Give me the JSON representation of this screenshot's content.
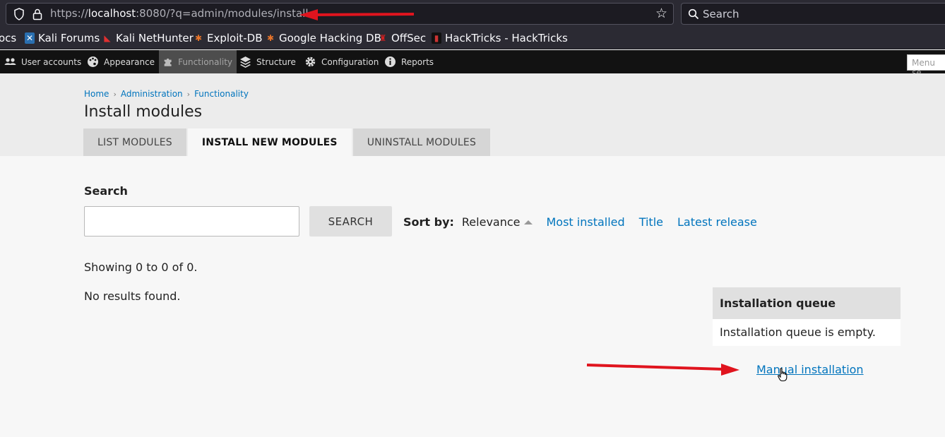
{
  "browser": {
    "url_scheme": "https://",
    "url_host": "localhost",
    "url_rest": ":8080/?q=admin/modules/install",
    "search_placeholder": "Search",
    "bookmarks": [
      {
        "label": "ocs",
        "icon": ""
      },
      {
        "label": "Kali Forums",
        "icon": "kali-forums-icon"
      },
      {
        "label": "Kali NetHunter",
        "icon": "nethunter-icon"
      },
      {
        "label": "Exploit-DB",
        "icon": "exploit-db-icon"
      },
      {
        "label": "Google Hacking DB",
        "icon": "ghdb-icon"
      },
      {
        "label": "OffSec",
        "icon": "offsec-icon"
      },
      {
        "label": "HackTricks - HackTricks",
        "icon": "hacktricks-icon"
      }
    ]
  },
  "toolbar": {
    "items": [
      {
        "label": "User accounts",
        "icon": "users-icon"
      },
      {
        "label": "Appearance",
        "icon": "palette-icon"
      },
      {
        "label": "Functionality",
        "icon": "puzzle-icon"
      },
      {
        "label": "Structure",
        "icon": "layers-icon"
      },
      {
        "label": "Configuration",
        "icon": "gear-icon"
      },
      {
        "label": "Reports",
        "icon": "info-icon"
      }
    ],
    "menu_search_placeholder": "Menu se"
  },
  "breadcrumb": [
    "Home",
    "Administration",
    "Functionality"
  ],
  "page_title": "Install modules",
  "tabs": [
    "LIST MODULES",
    "INSTALL NEW MODULES",
    "UNINSTALL MODULES"
  ],
  "search": {
    "label": "Search",
    "value": "",
    "button": "SEARCH"
  },
  "sort": {
    "label": "Sort by:",
    "current": "Relevance",
    "options": [
      "Most installed",
      "Title",
      "Latest release"
    ]
  },
  "results": {
    "showing": "Showing 0 to 0 of 0.",
    "empty": "No results found."
  },
  "queue": {
    "title": "Installation queue",
    "body": "Installation queue is empty."
  },
  "manual_link": "Manual installation",
  "colors": {
    "link": "#0074bd",
    "annotation_arrow": "#e0141e"
  }
}
